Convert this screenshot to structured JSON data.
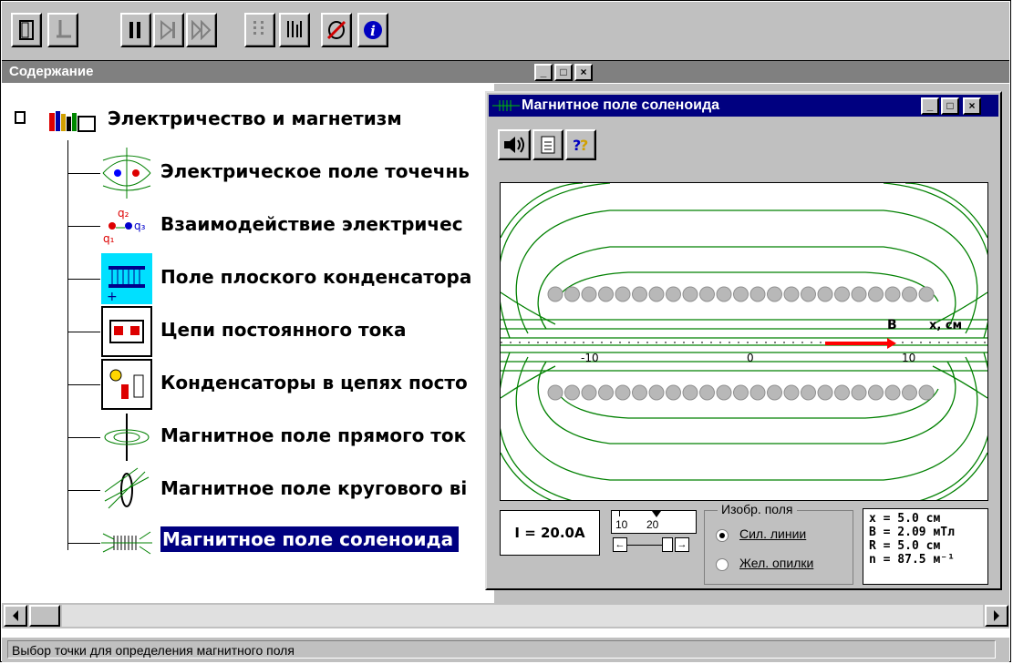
{
  "toolbar": {
    "buttons": [
      "exit-door-icon",
      "pointer-icon",
      "pause-icon",
      "step-icon",
      "fast-forward-icon",
      "grid-step-icon",
      "grid-icon",
      "sound-off-icon",
      "info-icon"
    ]
  },
  "contents": {
    "title": "Содержание",
    "root_label": "Электричество и магнетизм",
    "items": [
      {
        "label": "Электрическое поле точечнь",
        "icon": "electric-field-icon"
      },
      {
        "label": "Взаимодействие электричес",
        "icon": "charges-icon"
      },
      {
        "label": "Поле плоского конденсатора",
        "icon": "capacitor-icon"
      },
      {
        "label": "Цепи постоянного тока",
        "icon": "dc-circuit-icon"
      },
      {
        "label": "Конденсаторы в цепях посто",
        "icon": "capacitor-circuit-icon"
      },
      {
        "label": "Магнитное поле прямого ток",
        "icon": "straight-current-icon"
      },
      {
        "label": "Магнитное поле кругового ві",
        "icon": "circular-coil-icon"
      },
      {
        "label": "Магнитное поле соленоида",
        "icon": "solenoid-icon"
      }
    ],
    "window_buttons": {
      "minimize": "_",
      "maximize": "□",
      "close": "×"
    }
  },
  "solenoid_window": {
    "title": "Магнитное поле соленоида",
    "tool_buttons": [
      "speaker-icon",
      "document-icon",
      "help-icon"
    ],
    "plot": {
      "axis_label": "x, см",
      "vector_label": "B",
      "ticks": [
        "-10",
        "0",
        "10"
      ]
    },
    "current_label": "I = 20.0A",
    "slider": {
      "ticks": [
        "10",
        "20"
      ],
      "left": "←",
      "right": "→"
    },
    "field_group": {
      "title": "Изобр. поля",
      "options": [
        {
          "label": "Сил. линии",
          "selected": true
        },
        {
          "label": "Жел. опилки",
          "selected": false
        }
      ]
    },
    "readout": [
      "x  = 5.0 см",
      "B  = 2.09 мТл",
      "R  = 5.0 см",
      "n  = 87.5 м⁻¹"
    ]
  },
  "status": {
    "text": "Выбор точки для определения магнитного поля"
  },
  "colors": {
    "field_lines": "#008000",
    "selection": "#000080",
    "vector": "#ff0000"
  }
}
